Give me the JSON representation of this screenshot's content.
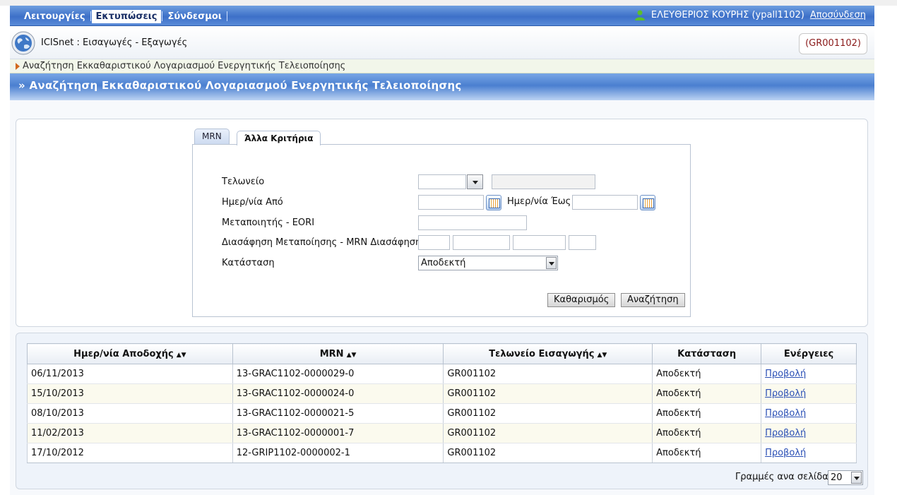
{
  "nav": {
    "items": [
      {
        "label": "Λειτουργίες"
      },
      {
        "label": "Εκτυπώσεις"
      },
      {
        "label": "Σύνδεσμοι"
      }
    ],
    "user": "ΕΛΕΥΘΕΡΙΟΣ ΚΟΥΡΗΣ (ypall1102)",
    "logout": "Αποσύνδεση"
  },
  "app": {
    "title": "ICISnet : Εισαγωγές - Εξαγωγές",
    "office_code": "(GR001102)"
  },
  "breadcrumb": "Αναζήτηση Εκκαθαριστικού Λογαριασμού Ενεργητικής Τελειοποίησης",
  "page_title": "» Αναζήτηση Εκκαθαριστικού Λογαριασμού Ενεργητικής Τελειοποίησης",
  "tabs": [
    {
      "label": "MRN"
    },
    {
      "label": "Άλλα Κριτήρια"
    }
  ],
  "form": {
    "customs_label": "Τελωνείο",
    "customs_value": "",
    "customs_name": "",
    "date_from_label": "Ημερ/νία Από",
    "date_from_value": "",
    "date_to_label": "Ημερ/νία Έως",
    "date_to_value": "",
    "processor_label": "Μεταποιητής - EORI",
    "processor_value": "",
    "declaration_label": "Διασάφηση Μεταποίησης - MRN Διασάφησης",
    "status_label": "Κατάσταση",
    "status_value": "Αποδεκτή",
    "clear_button": "Καθαρισμός",
    "search_button": "Αναζήτηση"
  },
  "table": {
    "columns": [
      "Ημερ/νία Αποδοχής",
      "MRN",
      "Τελωνείο Εισαγωγής",
      "Κατάσταση",
      "Ενέργειες"
    ],
    "rows": [
      {
        "date": "06/11/2013",
        "mrn": "13-GRAC1102-0000029-0",
        "office": "GR001102",
        "status": "Αποδεκτή",
        "action": "Προβολή"
      },
      {
        "date": "15/10/2013",
        "mrn": "13-GRAC1102-0000024-0",
        "office": "GR001102",
        "status": "Αποδεκτή",
        "action": "Προβολή"
      },
      {
        "date": "08/10/2013",
        "mrn": "13-GRAC1102-0000021-5",
        "office": "GR001102",
        "status": "Αποδεκτή",
        "action": "Προβολή"
      },
      {
        "date": "11/02/2013",
        "mrn": "13-GRAC1102-0000001-7",
        "office": "GR001102",
        "status": "Αποδεκτή",
        "action": "Προβολή"
      },
      {
        "date": "17/10/2012",
        "mrn": "12-GRIP1102-0000002-1",
        "office": "GR001102",
        "status": "Αποδεκτή",
        "action": "Προβολή"
      }
    ]
  },
  "pagination": {
    "rows_per_page_label": "Γραμμές ανα σελίδα:",
    "rows_per_page_value": "20"
  },
  "icons": {
    "user": "user-icon",
    "globe": "globe-icon",
    "calendar": "calendar-icon",
    "dropdown": "chevron-down-icon",
    "sort": "sort-icon"
  },
  "colors": {
    "nav_blue": "#3d70c8",
    "header_blue": "#4a7fd0",
    "link_blue": "#2a4fb5",
    "office_code_red": "#8a1a1a",
    "user_icon_green": "#5cbf2a"
  }
}
